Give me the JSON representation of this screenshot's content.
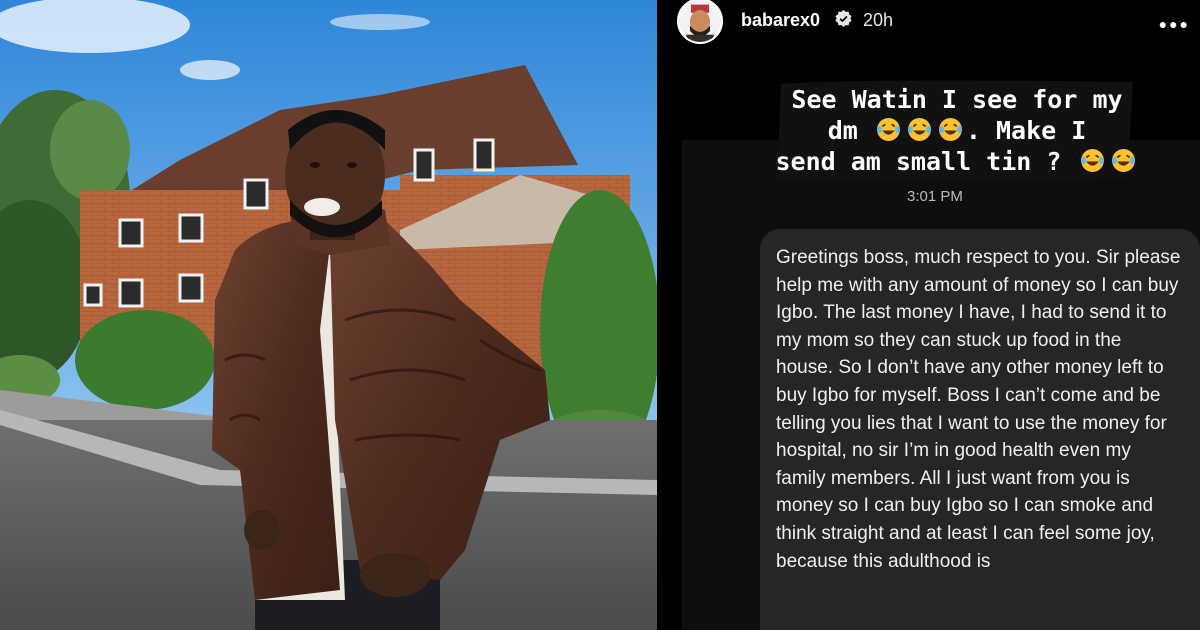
{
  "story": {
    "username": "babarex0",
    "post_time": "20h",
    "caption": {
      "line1": "See Watin I see for my",
      "line2_a": "dm",
      "line2_b": ".  Make I",
      "line3_a": "send am small tin ?"
    },
    "message_time": "3:01 PM",
    "message": "Greetings boss, much respect to you. Sir please help me with any amount of money so I can buy Igbo. The last money I have, I had to send it to my mom so they can stuck up food in the house. So I don’t have any other money left to buy Igbo for myself. Boss I can’t come and be telling you lies that I want to use the money for hospital, no sir I’m in good health even my family members. All I just want from you is money so I can buy Igbo so I can smoke and think straight and at least I can feel some joy, because this adulthood is",
    "icons": {
      "verified": "verified-badge-icon",
      "more": "more-options-icon",
      "emoji": "laughing-tears-emoji"
    }
  },
  "colors": {
    "panel_bg": "#000000",
    "bubble_bg": "#262626",
    "verified_blue": "#3897f0"
  }
}
